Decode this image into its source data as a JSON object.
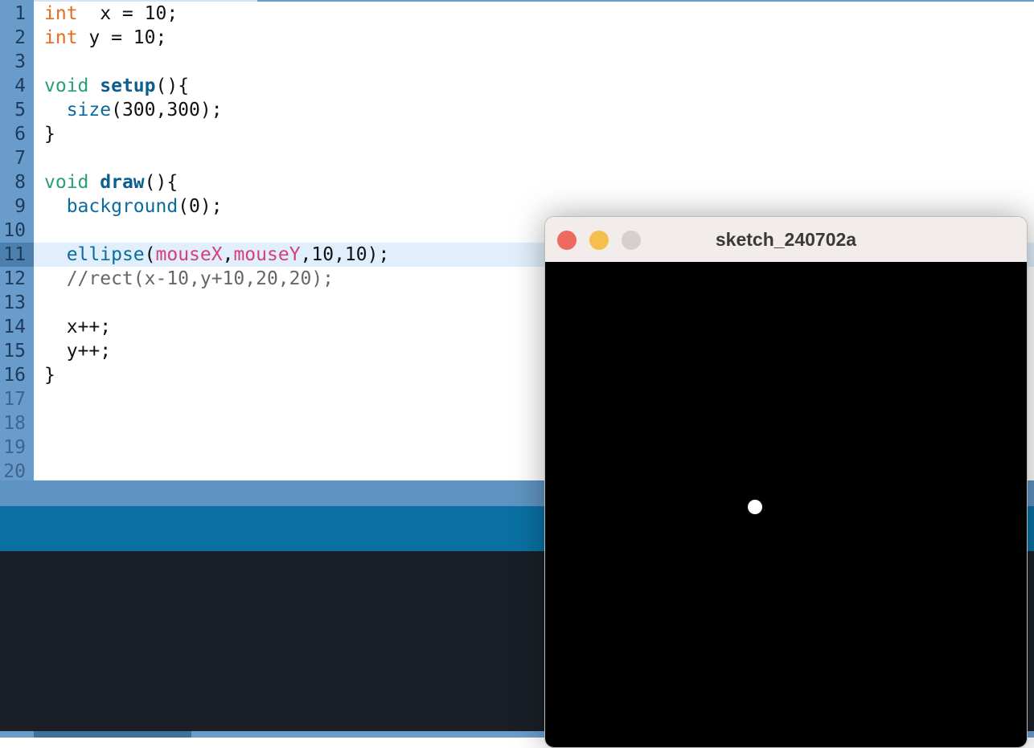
{
  "editor": {
    "lines": [
      {
        "n": "1",
        "tokens": [
          [
            "kw-type",
            "int"
          ],
          [
            "",
            "  x = 10;"
          ]
        ]
      },
      {
        "n": "2",
        "tokens": [
          [
            "kw-type",
            "int"
          ],
          [
            "",
            " y = 10;"
          ]
        ]
      },
      {
        "n": "3",
        "tokens": []
      },
      {
        "n": "4",
        "tokens": [
          [
            "kw-void",
            "void"
          ],
          [
            "",
            " "
          ],
          [
            "fn-bold",
            "setup"
          ],
          [
            "",
            "(){"
          ]
        ]
      },
      {
        "n": "5",
        "tokens": [
          [
            "",
            "  "
          ],
          [
            "fn",
            "size"
          ],
          [
            "",
            "(300,300);"
          ]
        ]
      },
      {
        "n": "6",
        "tokens": [
          [
            "",
            "}"
          ]
        ]
      },
      {
        "n": "7",
        "tokens": []
      },
      {
        "n": "8",
        "tokens": [
          [
            "kw-void",
            "void"
          ],
          [
            "",
            " "
          ],
          [
            "fn-bold",
            "draw"
          ],
          [
            "",
            "(){"
          ]
        ]
      },
      {
        "n": "9",
        "tokens": [
          [
            "",
            "  "
          ],
          [
            "fn",
            "background"
          ],
          [
            "",
            "(0);"
          ]
        ]
      },
      {
        "n": "10",
        "tokens": []
      },
      {
        "n": "11",
        "tokens": [
          [
            "",
            "  "
          ],
          [
            "fn",
            "ellipse"
          ],
          [
            "",
            "("
          ],
          [
            "var",
            "mouseX"
          ],
          [
            "",
            ","
          ],
          [
            "var",
            "mouseY"
          ],
          [
            "",
            ",10,10);"
          ]
        ],
        "active": true
      },
      {
        "n": "12",
        "tokens": [
          [
            "cm",
            "  //rect(x-10,y+10,20,20);"
          ]
        ]
      },
      {
        "n": "13",
        "tokens": []
      },
      {
        "n": "14",
        "tokens": [
          [
            "",
            "  x++;"
          ]
        ]
      },
      {
        "n": "15",
        "tokens": [
          [
            "",
            "  y++;"
          ]
        ]
      },
      {
        "n": "16",
        "tokens": [
          [
            "",
            "}"
          ]
        ]
      },
      {
        "n": "17",
        "tokens": [],
        "dim": true
      },
      {
        "n": "18",
        "tokens": [],
        "dim": true
      },
      {
        "n": "19",
        "tokens": [],
        "dim": true
      },
      {
        "n": "20",
        "tokens": [],
        "dim": true
      }
    ]
  },
  "sketch_window": {
    "title": "sketch_240702a",
    "buttons": {
      "close": "#ec6a5e",
      "minimize": "#f4bf4f",
      "zoom": "#d5d0ce"
    },
    "canvas_background": "#000000",
    "ellipse_color": "#ffffff"
  }
}
